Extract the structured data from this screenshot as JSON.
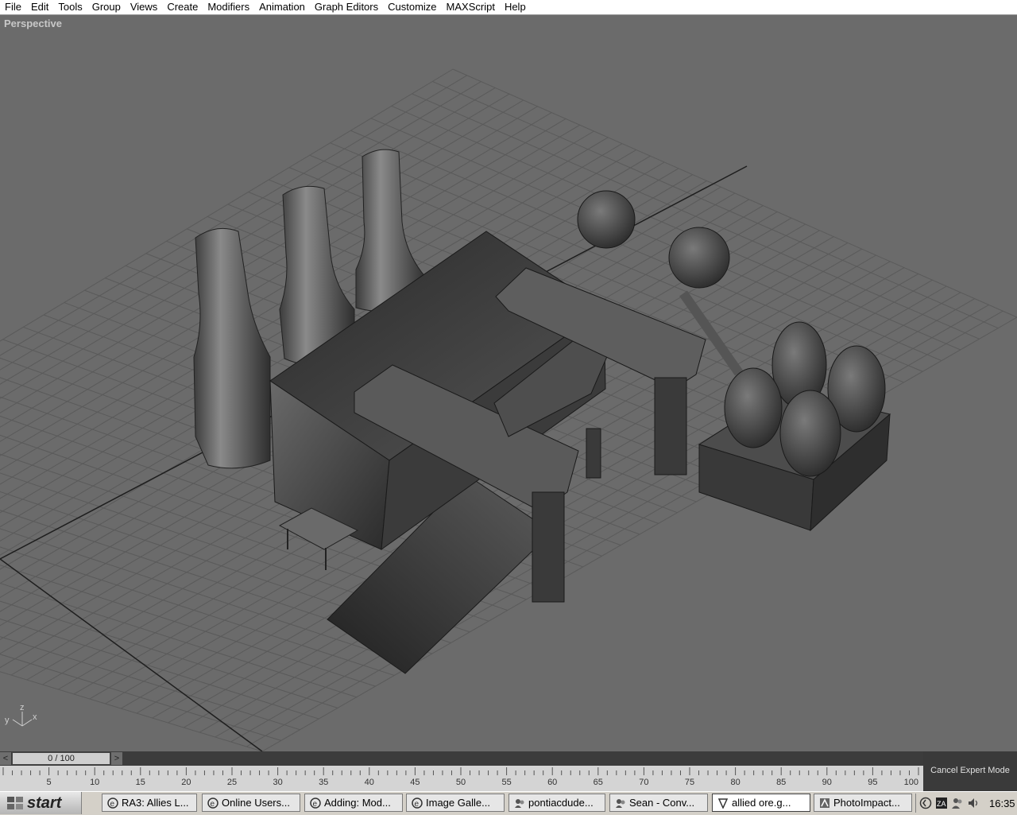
{
  "menu": [
    "File",
    "Edit",
    "Tools",
    "Group",
    "Views",
    "Create",
    "Modifiers",
    "Animation",
    "Graph Editors",
    "Customize",
    "MAXScript",
    "Help"
  ],
  "viewport": {
    "label": "Perspective",
    "axis": {
      "x": "x",
      "y": "y",
      "z": "z"
    }
  },
  "timeslider": {
    "position": "0 / 100",
    "prev_arrow": "<",
    "next_arrow": ">"
  },
  "track": {
    "ticks": [
      "5",
      "10",
      "15",
      "20",
      "25",
      "30",
      "35",
      "40",
      "45",
      "50",
      "55",
      "60",
      "65",
      "70",
      "75",
      "80",
      "85",
      "90",
      "95",
      "100"
    ]
  },
  "expert": {
    "cancel_label": "Cancel Expert Mode"
  },
  "taskbar": {
    "start_label": "start",
    "tasks": [
      {
        "label": "RA3: Allies L...",
        "icon": "ie-icon"
      },
      {
        "label": "Online Users...",
        "icon": "ie-icon"
      },
      {
        "label": "Adding: Mod...",
        "icon": "ie-icon"
      },
      {
        "label": "Image Galle...",
        "icon": "ie-icon"
      },
      {
        "label": "pontiacdude...",
        "icon": "messenger-icon"
      },
      {
        "label": "Sean - Conv...",
        "icon": "messenger-icon"
      },
      {
        "label": "allied ore.g...",
        "icon": "max-icon",
        "active": true
      },
      {
        "label": "PhotoImpact...",
        "icon": "photoimpact-icon"
      }
    ],
    "tray": {
      "clock": "16:35",
      "zonealarm_label": "ZA"
    }
  }
}
